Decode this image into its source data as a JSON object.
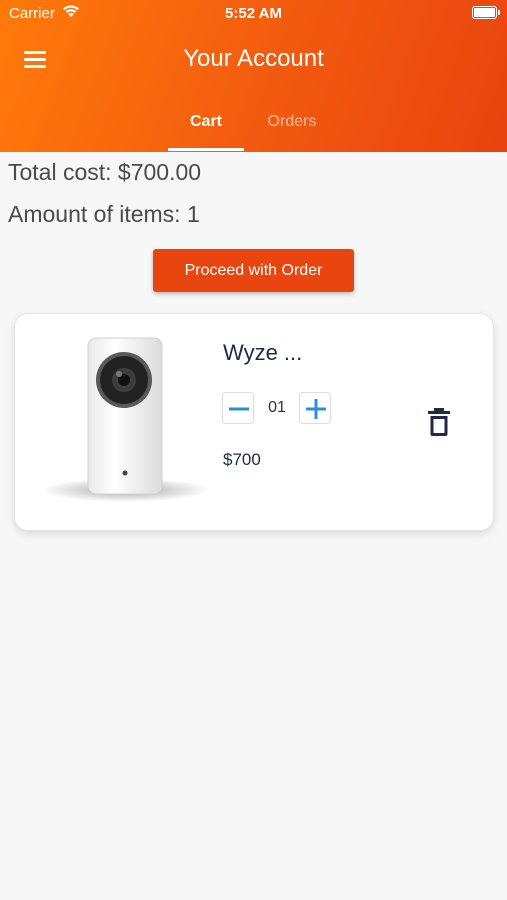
{
  "status_bar": {
    "carrier": "Carrier",
    "time": "5:52 AM"
  },
  "header": {
    "title": "Your Account"
  },
  "tabs": [
    {
      "label": "Cart",
      "active": true
    },
    {
      "label": "Orders",
      "active": false
    }
  ],
  "summary": {
    "total_cost": "Total cost: $700.00",
    "amount_of_items": "Amount of items: 1"
  },
  "proceed_button": "Proceed with Order",
  "cart_items": [
    {
      "name": "Wyze ...",
      "quantity": "01",
      "price": "$700",
      "image": "security-camera",
      "controls": {
        "decrement_icon": "minus-icon",
        "increment_icon": "plus-icon",
        "remove_icon": "trash-icon"
      }
    }
  ],
  "colors": {
    "header_gradient_start": "#ff7a0a",
    "header_gradient_end": "#e8430f",
    "accent_button": "#e9450f",
    "stepper_icon": "#2a8fd6",
    "dark_text": "#1f2a44"
  }
}
